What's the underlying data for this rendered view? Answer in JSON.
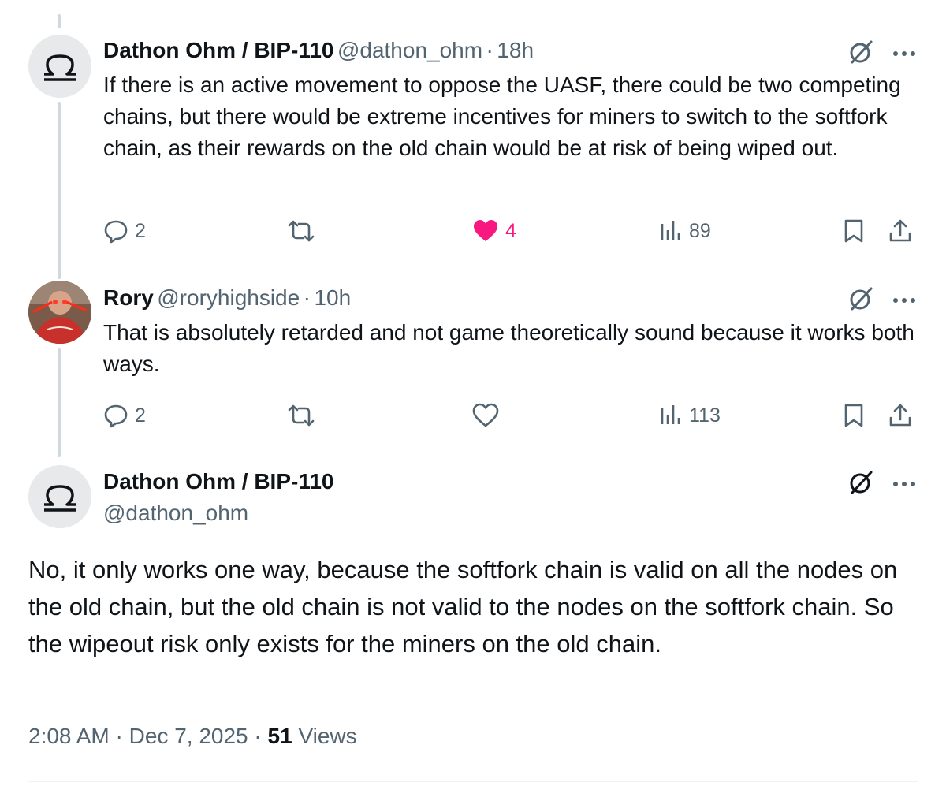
{
  "tweets": [
    {
      "name": "Dathon Ohm / BIP-110",
      "handle": "@dathon_ohm",
      "time": "18h",
      "text": "If there is an active movement to oppose the UASF, there could be two competing chains, but there would be extreme incentives for miners to switch to the softfork chain, as their rewards on the old chain would be at risk of being wiped out.",
      "replies": "2",
      "reposts": "",
      "likes": "4",
      "liked": true,
      "views": "89"
    },
    {
      "name": "Rory",
      "handle": "@roryhighside",
      "time": "10h",
      "text": "That is absolutely retarded and not game theoretically sound because it works both ways.",
      "replies": "2",
      "reposts": "",
      "likes": "",
      "liked": false,
      "views": "113"
    }
  ],
  "main_tweet": {
    "name": "Dathon Ohm / BIP-110",
    "handle": "@dathon_ohm",
    "text": "No, it only works one way, because the softfork chain is valid on all the nodes on the old chain, but the old chain is not valid to the nodes on the softfork chain. So the wipeout risk only exists for the miners on the old chain.",
    "time": "2:08 AM",
    "date": "Dec 7, 2025",
    "views_count": "51",
    "views_label": "Views",
    "separator": "·"
  },
  "icons": {
    "reply": "reply-icon",
    "repost": "repost-icon",
    "like": "heart-icon",
    "views": "views-icon",
    "bookmark": "bookmark-icon",
    "share": "share-icon",
    "grok": "grok-icon",
    "more": "more-icon"
  },
  "colors": {
    "like_active": "#f91880",
    "muted": "#536471",
    "text": "#0f1419",
    "thread_line": "#cfd9de"
  }
}
